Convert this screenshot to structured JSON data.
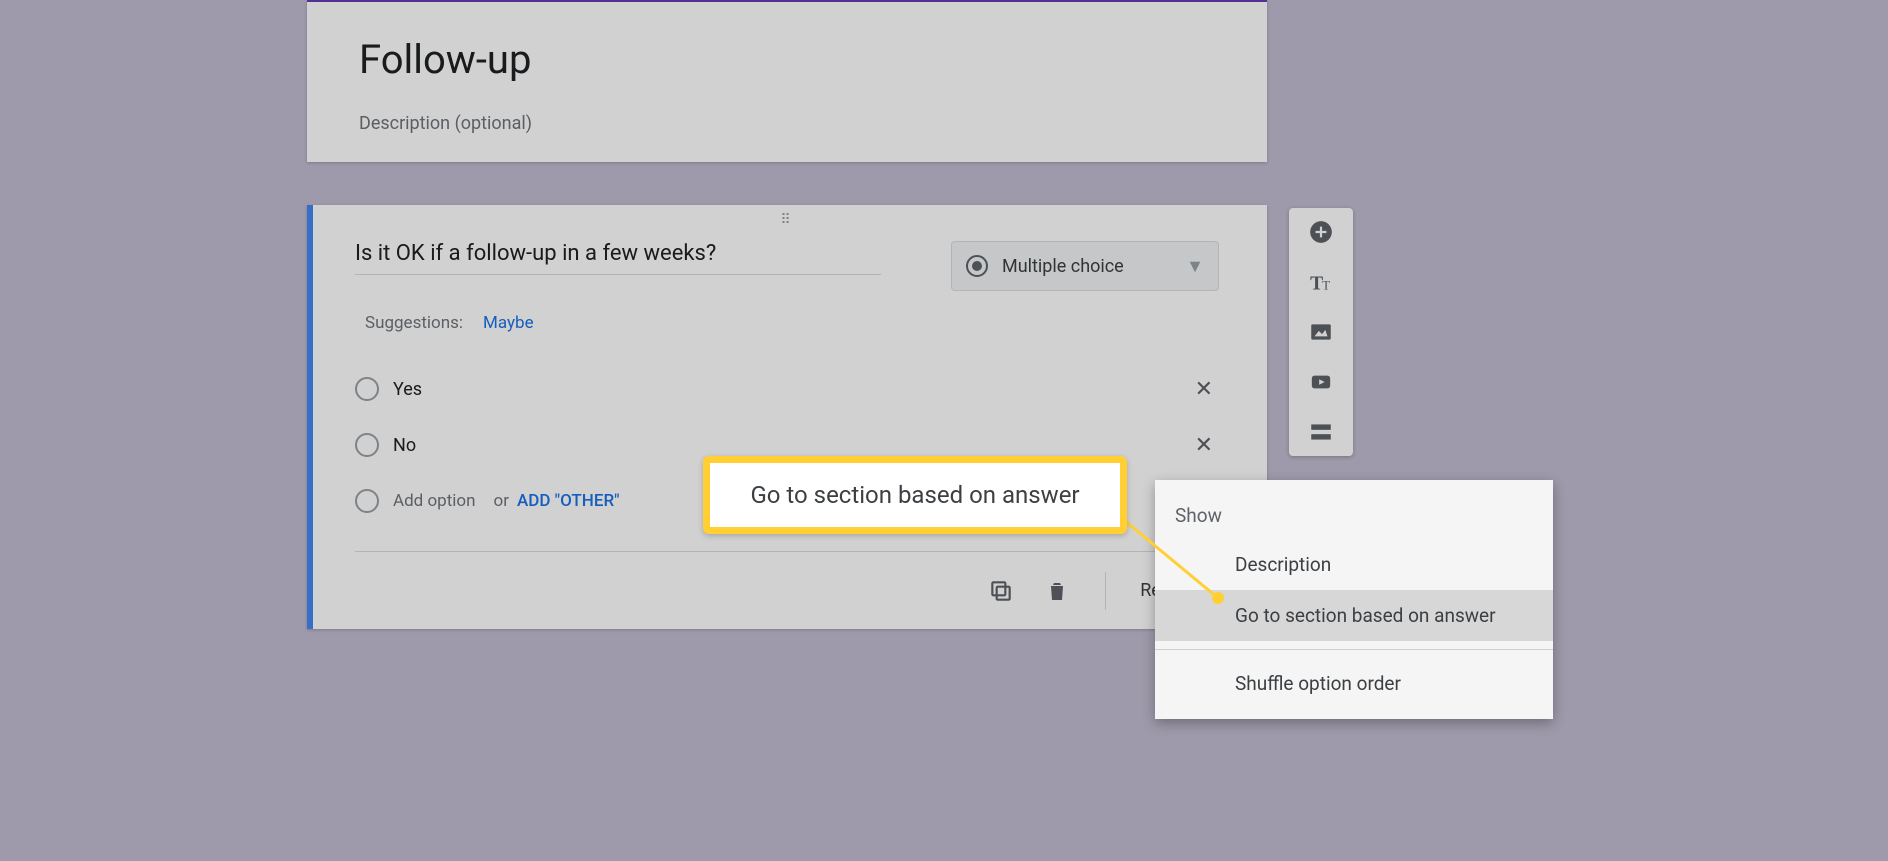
{
  "section": {
    "title": "Follow-up",
    "description_placeholder": "Description (optional)"
  },
  "question": {
    "text": "Is it OK if a follow-up in a few weeks?",
    "type_label": "Multiple choice",
    "suggestions_label": "Suggestions:",
    "suggestion_1": "Maybe",
    "options": [
      {
        "label": "Yes"
      },
      {
        "label": "No"
      }
    ],
    "add_option_label": "Add option",
    "or_label": "or",
    "add_other_label": "ADD \"OTHER\"",
    "required_label": "Required"
  },
  "menu": {
    "heading": "Show",
    "item_description": "Description",
    "item_goto": "Go to section based on answer",
    "item_shuffle": "Shuffle option order"
  },
  "callout": {
    "text": "Go to section based on answer"
  },
  "icons": {
    "add": "add-circle-icon",
    "title": "title-icon",
    "image": "image-icon",
    "video": "video-icon",
    "section": "section-icon",
    "copy": "copy-icon",
    "trash": "trash-icon"
  }
}
